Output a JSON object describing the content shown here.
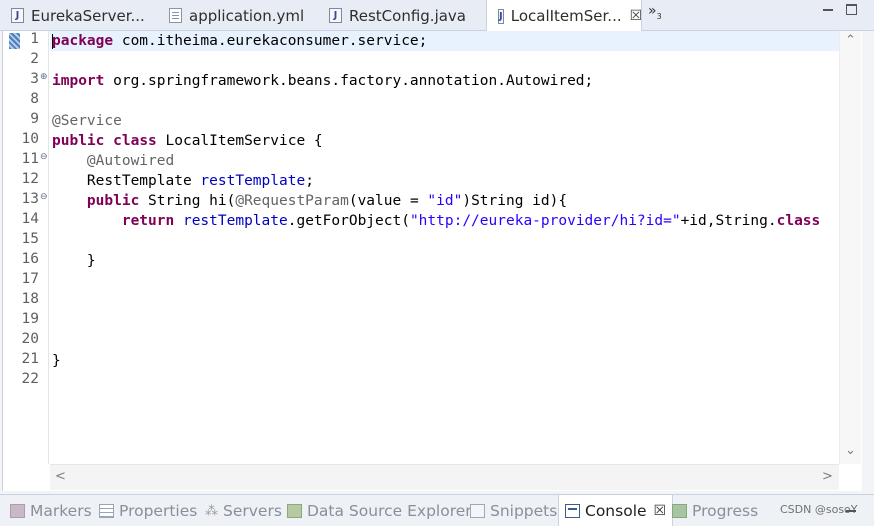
{
  "editor_tabs": [
    {
      "label": "EurekaServer...",
      "icon": "java-file-icon"
    },
    {
      "label": "application.yml",
      "icon": "yml-file-icon"
    },
    {
      "label": "RestConfig.java",
      "icon": "java-file-icon"
    },
    {
      "label": "LocalItemSer...",
      "icon": "java-file-icon",
      "active": true,
      "close": "☒"
    }
  ],
  "overflow": {
    "label": "»",
    "count": "3"
  },
  "code": {
    "line_numbers": [
      "1",
      "2",
      "3",
      "8",
      "9",
      "10",
      "11",
      "12",
      "13",
      "14",
      "15",
      "16",
      "17",
      "18",
      "19",
      "20",
      "21",
      "22"
    ],
    "lines": {
      "l1": {
        "kw": "package",
        "rest": " com.itheima.eurekaconsumer.service;"
      },
      "l3": {
        "kw": "import",
        "rest": " org.springframework.beans.factory.annotation.Autowired;"
      },
      "l9": {
        "an": "@Service"
      },
      "l10": {
        "kw1": "public",
        "kw2": "class",
        "rest": " LocalItemService {"
      },
      "l11": {
        "an": "@Autowired"
      },
      "l12": {
        "type": "RestTemplate ",
        "field": "restTemplate",
        "end": ";"
      },
      "l13": {
        "kw": "public",
        "a": " String hi(",
        "an": "@RequestParam",
        "b": "(value = ",
        "str": "\"id\"",
        "c": ")String id){"
      },
      "l14": {
        "kw": "return",
        "field": "restTemplate",
        "a": ".getForObject(",
        "str": "\"http://eureka-provider/hi?id=\"",
        "b": "+id,String.",
        "kw2": "class"
      },
      "l16": {
        "text": "}"
      },
      "l21": {
        "text": "}"
      }
    }
  },
  "bottom_tabs": [
    {
      "label": "Markers"
    },
    {
      "label": "Properties"
    },
    {
      "label": "Servers"
    },
    {
      "label": "Data Source Explorer"
    },
    {
      "label": "Snippets"
    },
    {
      "label": "Console",
      "active": true,
      "close": "☒"
    },
    {
      "label": "Progress"
    }
  ],
  "watermark": "CSDN @sosoY",
  "colors": {
    "keyword": "#7f0055",
    "annotation": "#646464",
    "field": "#0000c0",
    "string": "#2a00ff",
    "current_line": "#e8f2fe"
  }
}
